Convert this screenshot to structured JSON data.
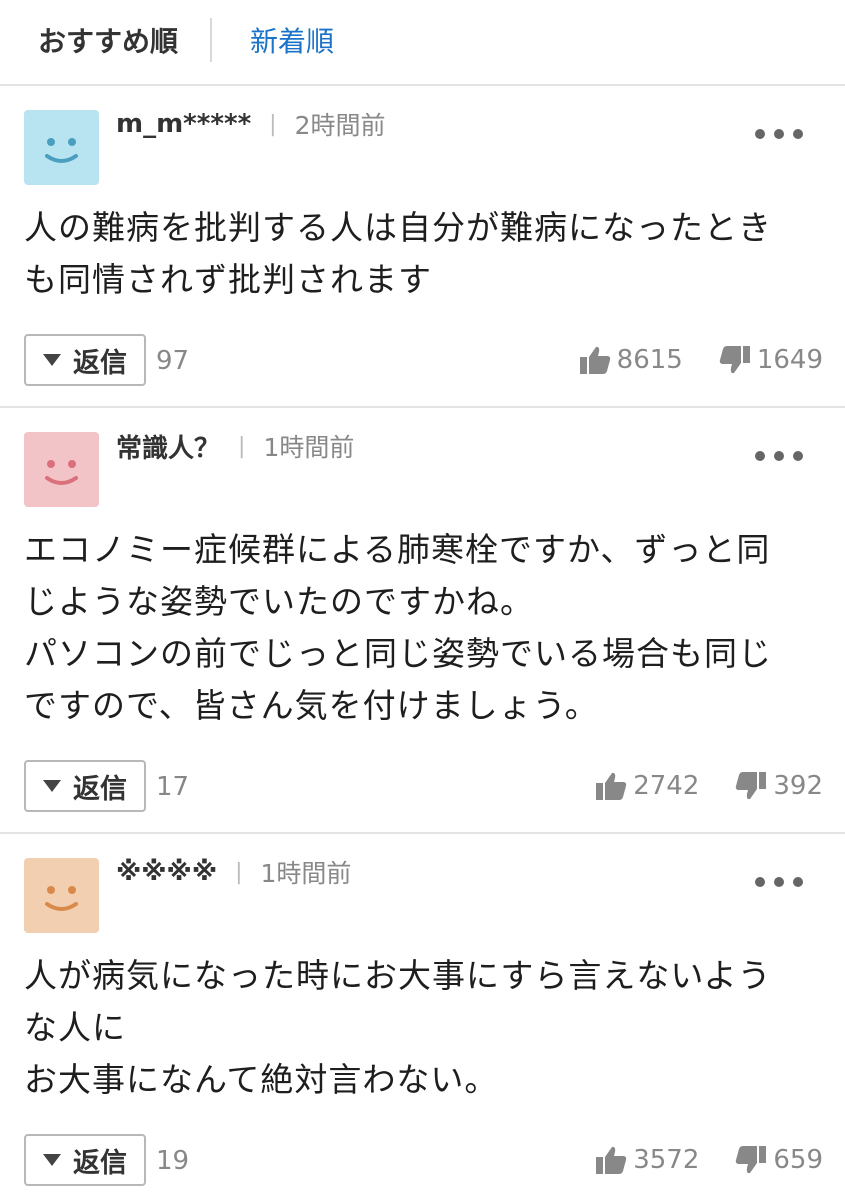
{
  "tabs": {
    "recommended": "おすすめ順",
    "newest": "新着順"
  },
  "comments": [
    {
      "author": "m_m*****",
      "time": "2時間前",
      "avatar_color": "#b7e4f0",
      "avatar_face": "#4a9fc0",
      "body": "人の難病を批判する人は自分が難病になったとき\nも同情されず批判されます",
      "reply_label": "返信",
      "reply_count": "97",
      "likes": "8615",
      "dislikes": "1649"
    },
    {
      "author": "常識人？",
      "time": "1時間前",
      "avatar_color": "#f2c4c8",
      "avatar_face": "#d9707c",
      "body": "エコノミー症候群による肺寒栓ですか、ずっと同\nじような姿勢でいたのですかね。\nパソコンの前でじっと同じ姿勢でいる場合も同じ\nですので、皆さん気を付けましょう。",
      "reply_label": "返信",
      "reply_count": "17",
      "likes": "2742",
      "dislikes": "392"
    },
    {
      "author": "※※※※",
      "time": "1時間前",
      "avatar_color": "#f2cfb0",
      "avatar_face": "#d98a4a",
      "body": "人が病気になった時にお大事にすら言えないよう\nな人に\nお大事になんて絶対言わない。",
      "reply_label": "返信",
      "reply_count": "19",
      "likes": "3572",
      "dislikes": "659"
    }
  ],
  "icons": {
    "thumbs_up": "thumbs-up-icon",
    "thumbs_down": "thumbs-down-icon",
    "more": "more-icon",
    "reply_arrow": "caret-down-icon"
  },
  "colors": {
    "tab_active": "#333333",
    "tab_link": "#1a73c8",
    "muted": "#888888",
    "divider": "#e4e4e4"
  }
}
